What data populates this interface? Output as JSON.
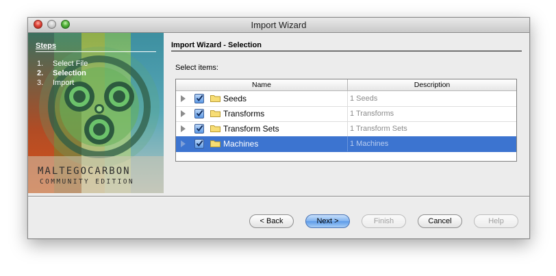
{
  "window": {
    "title": "Import Wizard"
  },
  "sidebar": {
    "heading": "Steps",
    "steps": [
      {
        "num": "1.",
        "label": "Select File",
        "active": false
      },
      {
        "num": "2.",
        "label": "Selection",
        "active": true
      },
      {
        "num": "3.",
        "label": "Import",
        "active": false
      }
    ],
    "logo_line1": "MALTEGOCARBON",
    "logo_line2": "COMMUNITY EDITION"
  },
  "panel": {
    "title": "Import Wizard - Selection",
    "select_label": "Select items:"
  },
  "table": {
    "columns": [
      "Name",
      "Description"
    ],
    "rows": [
      {
        "name": "Seeds",
        "description": "1 Seeds",
        "checked": true,
        "selected": false
      },
      {
        "name": "Transforms",
        "description": "1 Transforms",
        "checked": true,
        "selected": false
      },
      {
        "name": "Transform Sets",
        "description": "1 Transform Sets",
        "checked": true,
        "selected": false
      },
      {
        "name": "Machines",
        "description": "1 Machines",
        "checked": true,
        "selected": true
      }
    ]
  },
  "buttons": {
    "back": "< Back",
    "next": "Next >",
    "finish": "Finish",
    "cancel": "Cancel",
    "help": "Help"
  },
  "colors": {
    "selection": "#3c74d0",
    "default_button": "#7fb2ef"
  }
}
